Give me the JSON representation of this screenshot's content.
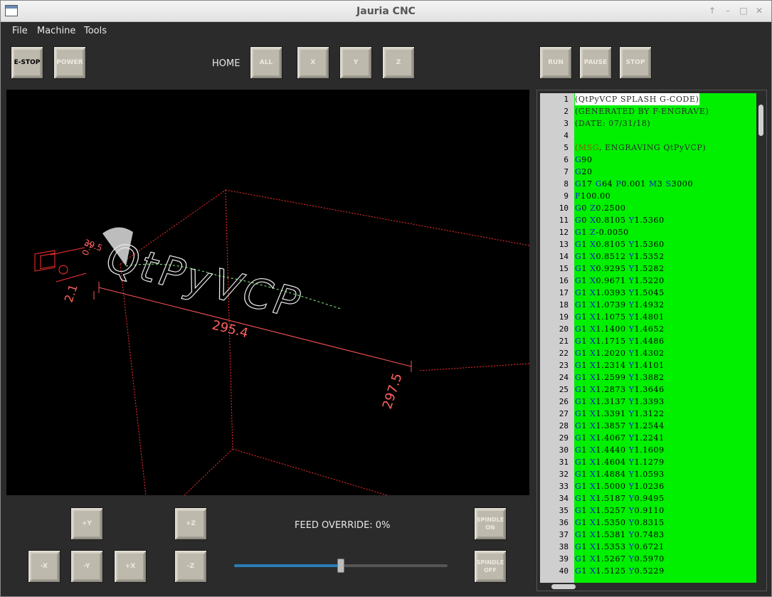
{
  "window": {
    "title": "Jauria CNC"
  },
  "menu": [
    "File",
    "Machine",
    "Tools"
  ],
  "toolbar": {
    "estop": "E-STOP",
    "power": "POWER",
    "home_label": "HOME",
    "home_all": "ALL",
    "home_x": "X",
    "home_y": "Y",
    "home_z": "Z",
    "run": "RUN",
    "pause": "PAUSE",
    "stop": "STOP"
  },
  "viewer": {
    "engraving_text": "QtPyVCP",
    "dims": {
      "width": "295.4",
      "depth": "297.5",
      "height": "2.1",
      "tool_a": "39.5",
      "tool_b": "0.5"
    }
  },
  "jog": {
    "plus_y": "+Y",
    "minus_x": "-X",
    "minus_y": "-Y",
    "plus_x": "+X",
    "plus_z": "+Z",
    "minus_z": "-Z"
  },
  "feed": {
    "label": "FEED OVERRIDE: 0%",
    "fraction": 0.5
  },
  "spindle": {
    "on": "SPINDLE ON",
    "off": "SPINDLE OFF"
  },
  "gcode": {
    "lines": [
      "(QtPyVCP SPLASH G-CODE)",
      "(GENERATED BY F-ENGRAVE)",
      "(DATE: 07/31/18)",
      "",
      "(MSG, ENGRAVING QtPyVCP)",
      "G90",
      "G20",
      "G17 G64 P0.001 M3 S3000",
      "F100.00",
      "G0 Z0.2500",
      "G0 X0.8105 Y1.5360",
      "G1 Z-0.0050",
      "G1 X0.8105 Y1.5360",
      "G1 X0.8512 Y1.5352",
      "G1 X0.9295 Y1.5282",
      "G1 X0.9671 Y1.5220",
      "G1 X1.0393 Y1.5045",
      "G1 X1.0739 Y1.4932",
      "G1 X1.1075 Y1.4801",
      "G1 X1.1400 Y1.4652",
      "G1 X1.1715 Y1.4486",
      "G1 X1.2020 Y1.4302",
      "G1 X1.2314 Y1.4101",
      "G1 X1.2599 Y1.3882",
      "G1 X1.2873 Y1.3646",
      "G1 X1.3137 Y1.3393",
      "G1 X1.3391 Y1.3122",
      "G1 X1.3857 Y1.2544",
      "G1 X1.4067 Y1.2241",
      "G1 X1.4440 Y1.1609",
      "G1 X1.4604 Y1.1279",
      "G1 X1.4884 Y1.0593",
      "G1 X1.5000 Y1.0236",
      "G1 X1.5187 Y0.9495",
      "G1 X1.5257 Y0.9110",
      "G1 X1.5350 Y0.8315",
      "G1 X1.5381 Y0.7483",
      "G1 X1.5353 Y0.6721",
      "G1 X1.5267 Y0.5970",
      "G1 X1.5125 Y0.5229"
    ]
  }
}
